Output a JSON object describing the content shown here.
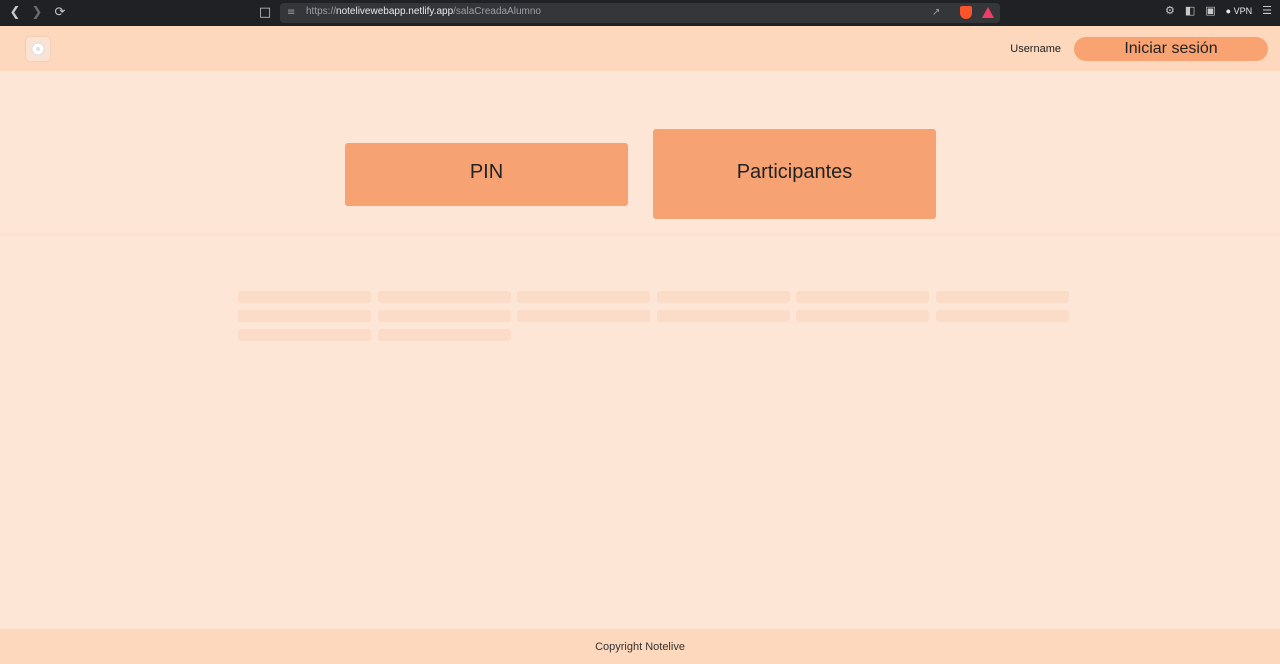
{
  "browser": {
    "url_scheme": "https://",
    "url_host": "notelivewebapp.netlify.app",
    "url_path": "/salaCreadaAlumno",
    "vpn_label": "VPN"
  },
  "header": {
    "username": "Username",
    "login_label": "Iniciar sesión"
  },
  "main": {
    "pin_label": "PIN",
    "participants_label": "Participantes",
    "skeleton_count": 14
  },
  "footer": {
    "copyright": "Copyright Notelive"
  },
  "colors": {
    "accent": "#f7a272",
    "header_bg": "#fed8bd",
    "page_bg": "#fee6d6"
  }
}
